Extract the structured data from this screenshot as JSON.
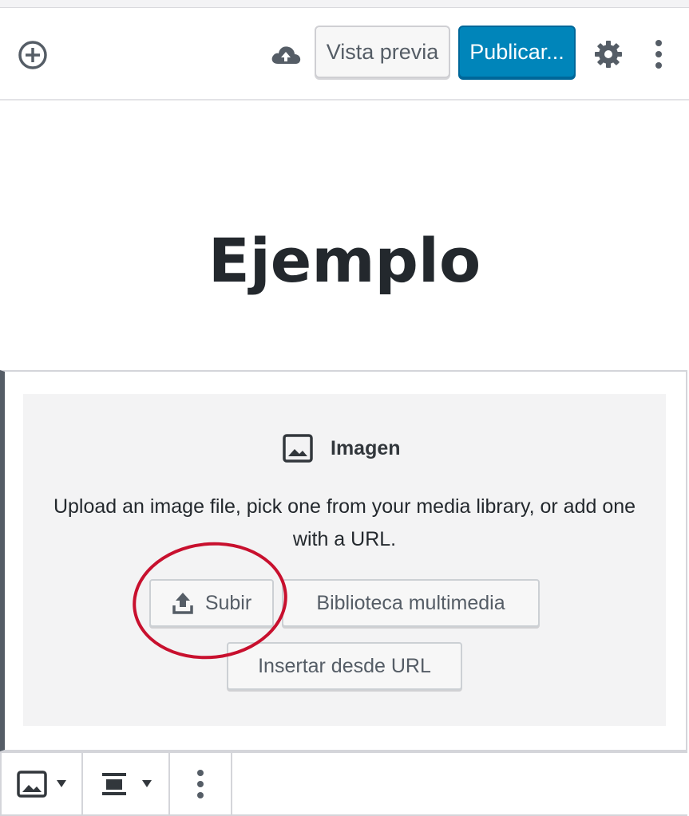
{
  "toolbar": {
    "add_block_icon": "plus-circle-icon",
    "save_icon": "cloud-upload-icon",
    "preview_label": "Vista previa",
    "publish_label": "Publicar...",
    "settings_icon": "gear-icon",
    "more_icon": "more-vertical-icon"
  },
  "post": {
    "title": "Ejemplo"
  },
  "image_block": {
    "label": "Imagen",
    "label_icon": "image-icon",
    "instructions": "Upload an image file, pick one from your media library, or add one with a URL.",
    "upload_label": "Subir",
    "upload_icon": "upload-icon",
    "media_library_label": "Biblioteca multimedia",
    "insert_url_label": "Insertar desde URL"
  },
  "block_toolbar": {
    "block_type_icon": "image-icon",
    "align_icon": "align-center-icon",
    "more_icon": "more-vertical-icon"
  },
  "colors": {
    "publish_bg": "#0085ba",
    "annotation": "#c8102e",
    "block_border": "#555d66"
  }
}
